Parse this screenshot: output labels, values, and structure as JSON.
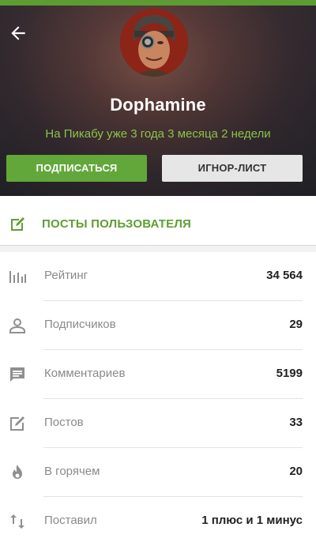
{
  "profile": {
    "username": "Dophamine",
    "since": "На Пикабу уже 3 года 3 месяца 2 недели"
  },
  "buttons": {
    "subscribe": "ПОДПИСАТЬСЯ",
    "ignore": "ИГНОР-ЛИСТ"
  },
  "posts_link": {
    "label": "ПОСТЫ ПОЛЬЗОВАТЕЛЯ",
    "icon": "edit-icon"
  },
  "stats": [
    {
      "label": "Рейтинг",
      "value": "34 564",
      "icon": "rating-bars-icon"
    },
    {
      "label": "Подписчиков",
      "value": "29",
      "icon": "person-icon"
    },
    {
      "label": "Комментариев",
      "value": "5199",
      "icon": "comment-icon"
    },
    {
      "label": "Постов",
      "value": "33",
      "icon": "edit-icon"
    },
    {
      "label": "В горячем",
      "value": "20",
      "icon": "fire-icon"
    },
    {
      "label": "Поставил",
      "value": "1 плюс и 1 минус",
      "icon": "up-down-arrows-icon"
    }
  ],
  "colors": {
    "accent_green": "#62a73a",
    "since_text": "#8bc34a",
    "status_bar": "#5d9c33"
  }
}
